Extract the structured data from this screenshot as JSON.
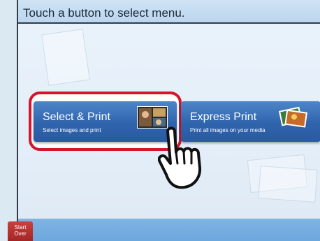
{
  "header": {
    "title": "Touch a button to select menu."
  },
  "buttons": [
    {
      "label": "Select & Print",
      "sub": "Select images and print"
    },
    {
      "label": "Express Print",
      "sub": "Print all images on your media"
    }
  ],
  "footer": {
    "start_over_line1": "Start",
    "start_over_line2": "Over"
  },
  "colors": {
    "highlight": "#d4162c",
    "button_blue": "#2f64ad",
    "footer": "#6ca7dd",
    "start_over": "#a32624"
  },
  "icons": [
    "photos-icon",
    "photo-stack-icon",
    "pointing-hand-icon"
  ]
}
